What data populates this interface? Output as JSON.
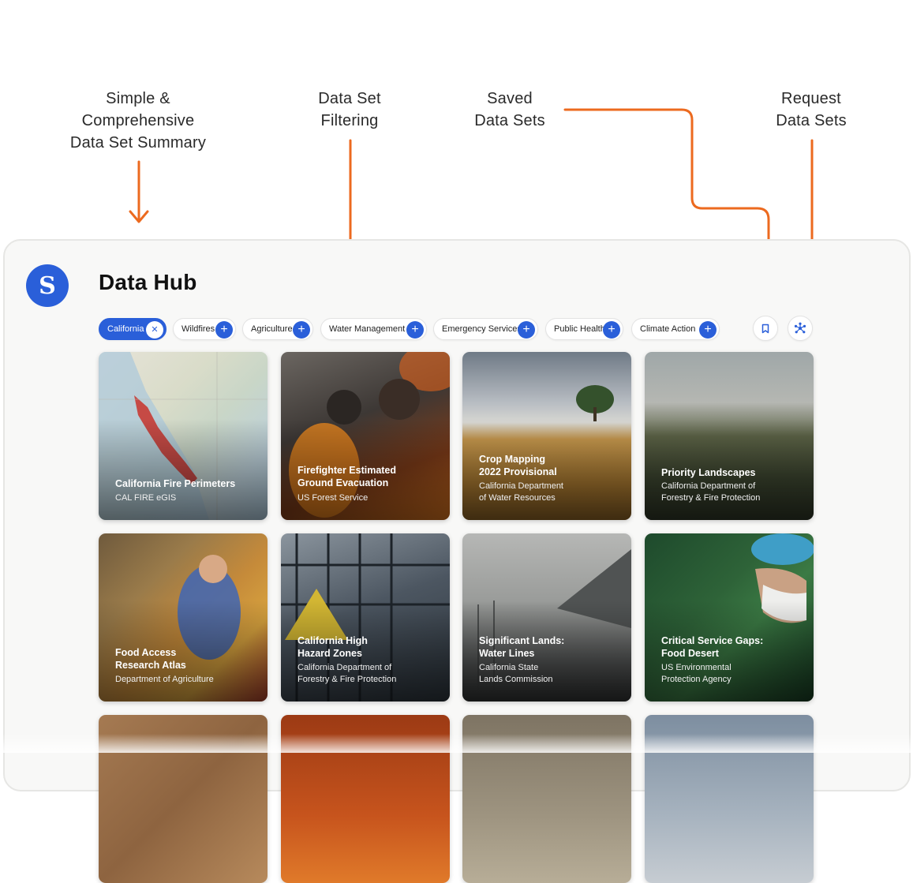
{
  "annotations": [
    {
      "text": "Simple &\nComprehensive\nData Set Summary"
    },
    {
      "text": "Data Set\nFiltering"
    },
    {
      "text": "Saved\nData Sets"
    },
    {
      "text": "Request\nData Sets"
    }
  ],
  "accent_color": "#ec6a1f",
  "brand_color": "#2a5fd9",
  "header": {
    "logo_glyph": "S",
    "title": "Data Hub"
  },
  "filters": [
    {
      "label": "California",
      "active": true,
      "icon": "close-icon"
    },
    {
      "label": "Wildfires",
      "active": false,
      "icon": "plus-icon"
    },
    {
      "label": "Agriculture",
      "active": false,
      "icon": "plus-icon"
    },
    {
      "label": "Water Management",
      "active": false,
      "icon": "plus-icon"
    },
    {
      "label": "Emergency Services",
      "active": false,
      "icon": "plus-icon"
    },
    {
      "label": "Public Health",
      "active": false,
      "icon": "plus-icon"
    },
    {
      "label": "Climate Action",
      "active": false,
      "icon": "plus-icon"
    }
  ],
  "toolbar": {
    "saved_icon": "bookmark-icon",
    "request_icon": "network-icon"
  },
  "cards": [
    {
      "title": "California Fire Perimeters",
      "source": "CAL FIRE eGIS"
    },
    {
      "title": "Firefighter Estimated\nGround Evacuation",
      "source": "US Forest Service"
    },
    {
      "title": "Crop Mapping\n2022 Provisional",
      "source": "California Department\nof Water Resources"
    },
    {
      "title": "Priority Landscapes",
      "source": "California Department of\nForestry & Fire Protection"
    },
    {
      "title": "Food Access\nResearch Atlas",
      "source": "Department of Agriculture"
    },
    {
      "title": "California High\nHazard Zones",
      "source": "California Department of\nForestry & Fire Protection"
    },
    {
      "title": "Significant Lands:\nWater Lines",
      "source": "California State\nLands Commission"
    },
    {
      "title": "Critical Service Gaps:\nFood Desert",
      "source": "US Environmental\nProtection Agency"
    },
    {
      "title": "",
      "source": ""
    },
    {
      "title": "",
      "source": ""
    },
    {
      "title": "",
      "source": ""
    },
    {
      "title": "",
      "source": ""
    }
  ]
}
